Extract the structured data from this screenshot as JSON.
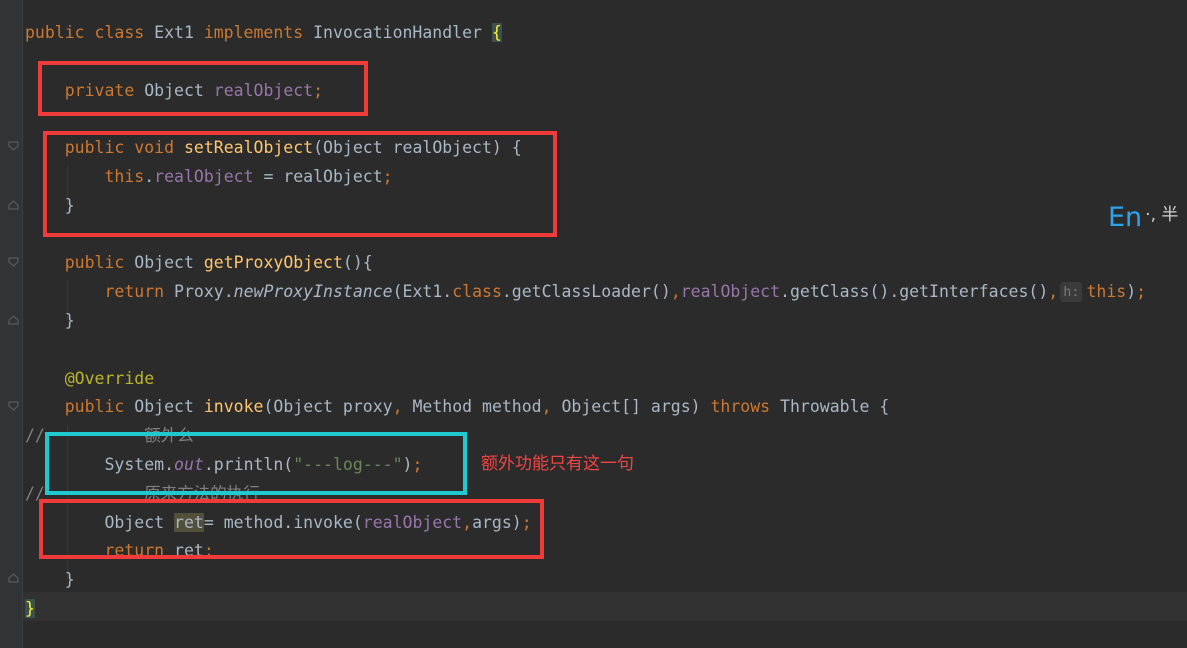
{
  "editor": {
    "lines": [
      {
        "id": "class-decl",
        "tokens": [
          {
            "t": "public class ",
            "c": "kw"
          },
          {
            "t": "Ext1 "
          },
          {
            "t": "implements ",
            "c": "kw"
          },
          {
            "t": "InvocationHandler "
          },
          {
            "t": "{",
            "c": "brace-hl"
          }
        ]
      },
      {
        "id": "blank-1",
        "tokens": []
      },
      {
        "id": "field-decl",
        "tokens": [
          {
            "t": "    "
          },
          {
            "t": "private ",
            "c": "kw"
          },
          {
            "t": "Object "
          },
          {
            "t": "realObject",
            "c": "fld"
          },
          {
            "t": ";",
            "c": "kw"
          }
        ]
      },
      {
        "id": "blank-2",
        "tokens": []
      },
      {
        "id": "setter-sig",
        "tokens": [
          {
            "t": "    "
          },
          {
            "t": "public void ",
            "c": "kw"
          },
          {
            "t": "setRealObject",
            "c": "fn"
          },
          {
            "t": "(Object realObject) {"
          }
        ]
      },
      {
        "id": "setter-body",
        "tokens": [
          {
            "t": "        "
          },
          {
            "t": "this",
            "c": "kw"
          },
          {
            "t": "."
          },
          {
            "t": "realObject",
            "c": "fld"
          },
          {
            "t": " = realObject"
          },
          {
            "t": ";",
            "c": "kw"
          }
        ]
      },
      {
        "id": "setter-end",
        "tokens": [
          {
            "t": "    }"
          }
        ]
      },
      {
        "id": "blank-3",
        "tokens": []
      },
      {
        "id": "getter-sig",
        "tokens": [
          {
            "t": "    "
          },
          {
            "t": "public ",
            "c": "kw"
          },
          {
            "t": "Object "
          },
          {
            "t": "getProxyObject",
            "c": "fn"
          },
          {
            "t": "(){"
          }
        ]
      },
      {
        "id": "getter-body",
        "tokens": [
          {
            "t": "        "
          },
          {
            "t": "return ",
            "c": "kw"
          },
          {
            "t": "Proxy."
          },
          {
            "t": "newProxyInstance",
            "c": "it"
          },
          {
            "t": "(Ext1."
          },
          {
            "t": "class",
            "c": "kw"
          },
          {
            "t": ".getClassLoader()"
          },
          {
            "t": ",",
            "c": "kw"
          },
          {
            "t": "realObject",
            "c": "fld"
          },
          {
            "t": ".getClass().getInterfaces()"
          },
          {
            "t": ",",
            "c": "kw"
          },
          {
            "t": "h:",
            "c": "hint"
          },
          {
            "t": "this",
            "c": "kw"
          },
          {
            "t": ")"
          },
          {
            "t": ";",
            "c": "kw"
          }
        ]
      },
      {
        "id": "getter-end",
        "tokens": [
          {
            "t": "    }"
          }
        ]
      },
      {
        "id": "blank-4",
        "tokens": []
      },
      {
        "id": "annotation",
        "tokens": [
          {
            "t": "    "
          },
          {
            "t": "@Override",
            "c": "ann"
          }
        ]
      },
      {
        "id": "invoke-sig",
        "tokens": [
          {
            "t": "    "
          },
          {
            "t": "public ",
            "c": "kw"
          },
          {
            "t": "Object "
          },
          {
            "t": "invoke",
            "c": "fn"
          },
          {
            "t": "(Object proxy"
          },
          {
            "t": ", ",
            "c": "kw"
          },
          {
            "t": "Method method"
          },
          {
            "t": ", ",
            "c": "kw"
          },
          {
            "t": "Object[] args) "
          },
          {
            "t": "throws ",
            "c": "kw"
          },
          {
            "t": "Throwable {"
          }
        ]
      },
      {
        "id": "comment-1",
        "tokens": [
          {
            "t": "//          额外么",
            "c": "cmt"
          }
        ]
      },
      {
        "id": "println",
        "tokens": [
          {
            "t": "        System."
          },
          {
            "t": "out",
            "c": "fld it"
          },
          {
            "t": ".println("
          },
          {
            "t": "\"---log---\"",
            "c": "str"
          },
          {
            "t": ")"
          },
          {
            "t": ";",
            "c": "kw"
          }
        ]
      },
      {
        "id": "comment-2",
        "tokens": [
          {
            "t": "//          原来方法的执行",
            "c": "cmt"
          }
        ]
      },
      {
        "id": "invoke-call",
        "tokens": [
          {
            "t": "        Object "
          },
          {
            "t": "ret",
            "c": "var-hl"
          },
          {
            "t": "= method.invoke("
          },
          {
            "t": "realObject",
            "c": "fld"
          },
          {
            "t": ",",
            "c": "kw"
          },
          {
            "t": "args)"
          },
          {
            "t": ";",
            "c": "kw"
          }
        ]
      },
      {
        "id": "return-ret",
        "tokens": [
          {
            "t": "        "
          },
          {
            "t": "return ",
            "c": "kw"
          },
          {
            "t": "ret"
          },
          {
            "t": ";",
            "c": "kw"
          }
        ]
      },
      {
        "id": "invoke-end",
        "tokens": [
          {
            "t": "    }"
          }
        ]
      },
      {
        "id": "class-end",
        "tokens": [
          {
            "t": "}",
            "c": "brace-hl"
          }
        ]
      }
    ]
  },
  "annotation_note": "额外功能只有这一句",
  "ime_indicator": {
    "mode": "En",
    "rest": "·, 半"
  },
  "colors": {
    "red_box": "#f03b3b",
    "cyan_box": "#1ec9cf",
    "background": "#2b2b2b"
  }
}
